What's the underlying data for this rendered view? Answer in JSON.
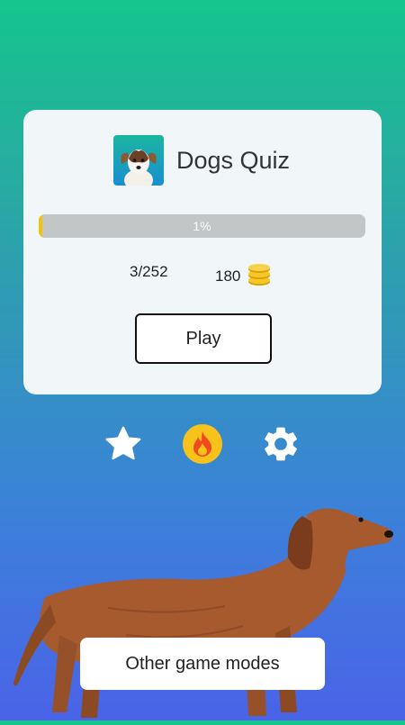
{
  "app": {
    "title": "Dogs Quiz",
    "icon": "dog-photo-icon"
  },
  "progress": {
    "percent": 1,
    "label": "1%"
  },
  "stats": {
    "answered": "3/252",
    "coins": "180",
    "coin_icon": "coin-stack-icon"
  },
  "buttons": {
    "play": "Play",
    "other_modes": "Other game modes"
  },
  "toolbar": [
    {
      "icon": "star-icon",
      "color": "#ffffff"
    },
    {
      "icon": "fire-icon",
      "color": "#f7c21b"
    },
    {
      "icon": "gear-icon",
      "color": "#ffffff"
    }
  ],
  "colors": {
    "accent_yellow": "#f5c400",
    "progress_track": "#c3c6c7"
  }
}
